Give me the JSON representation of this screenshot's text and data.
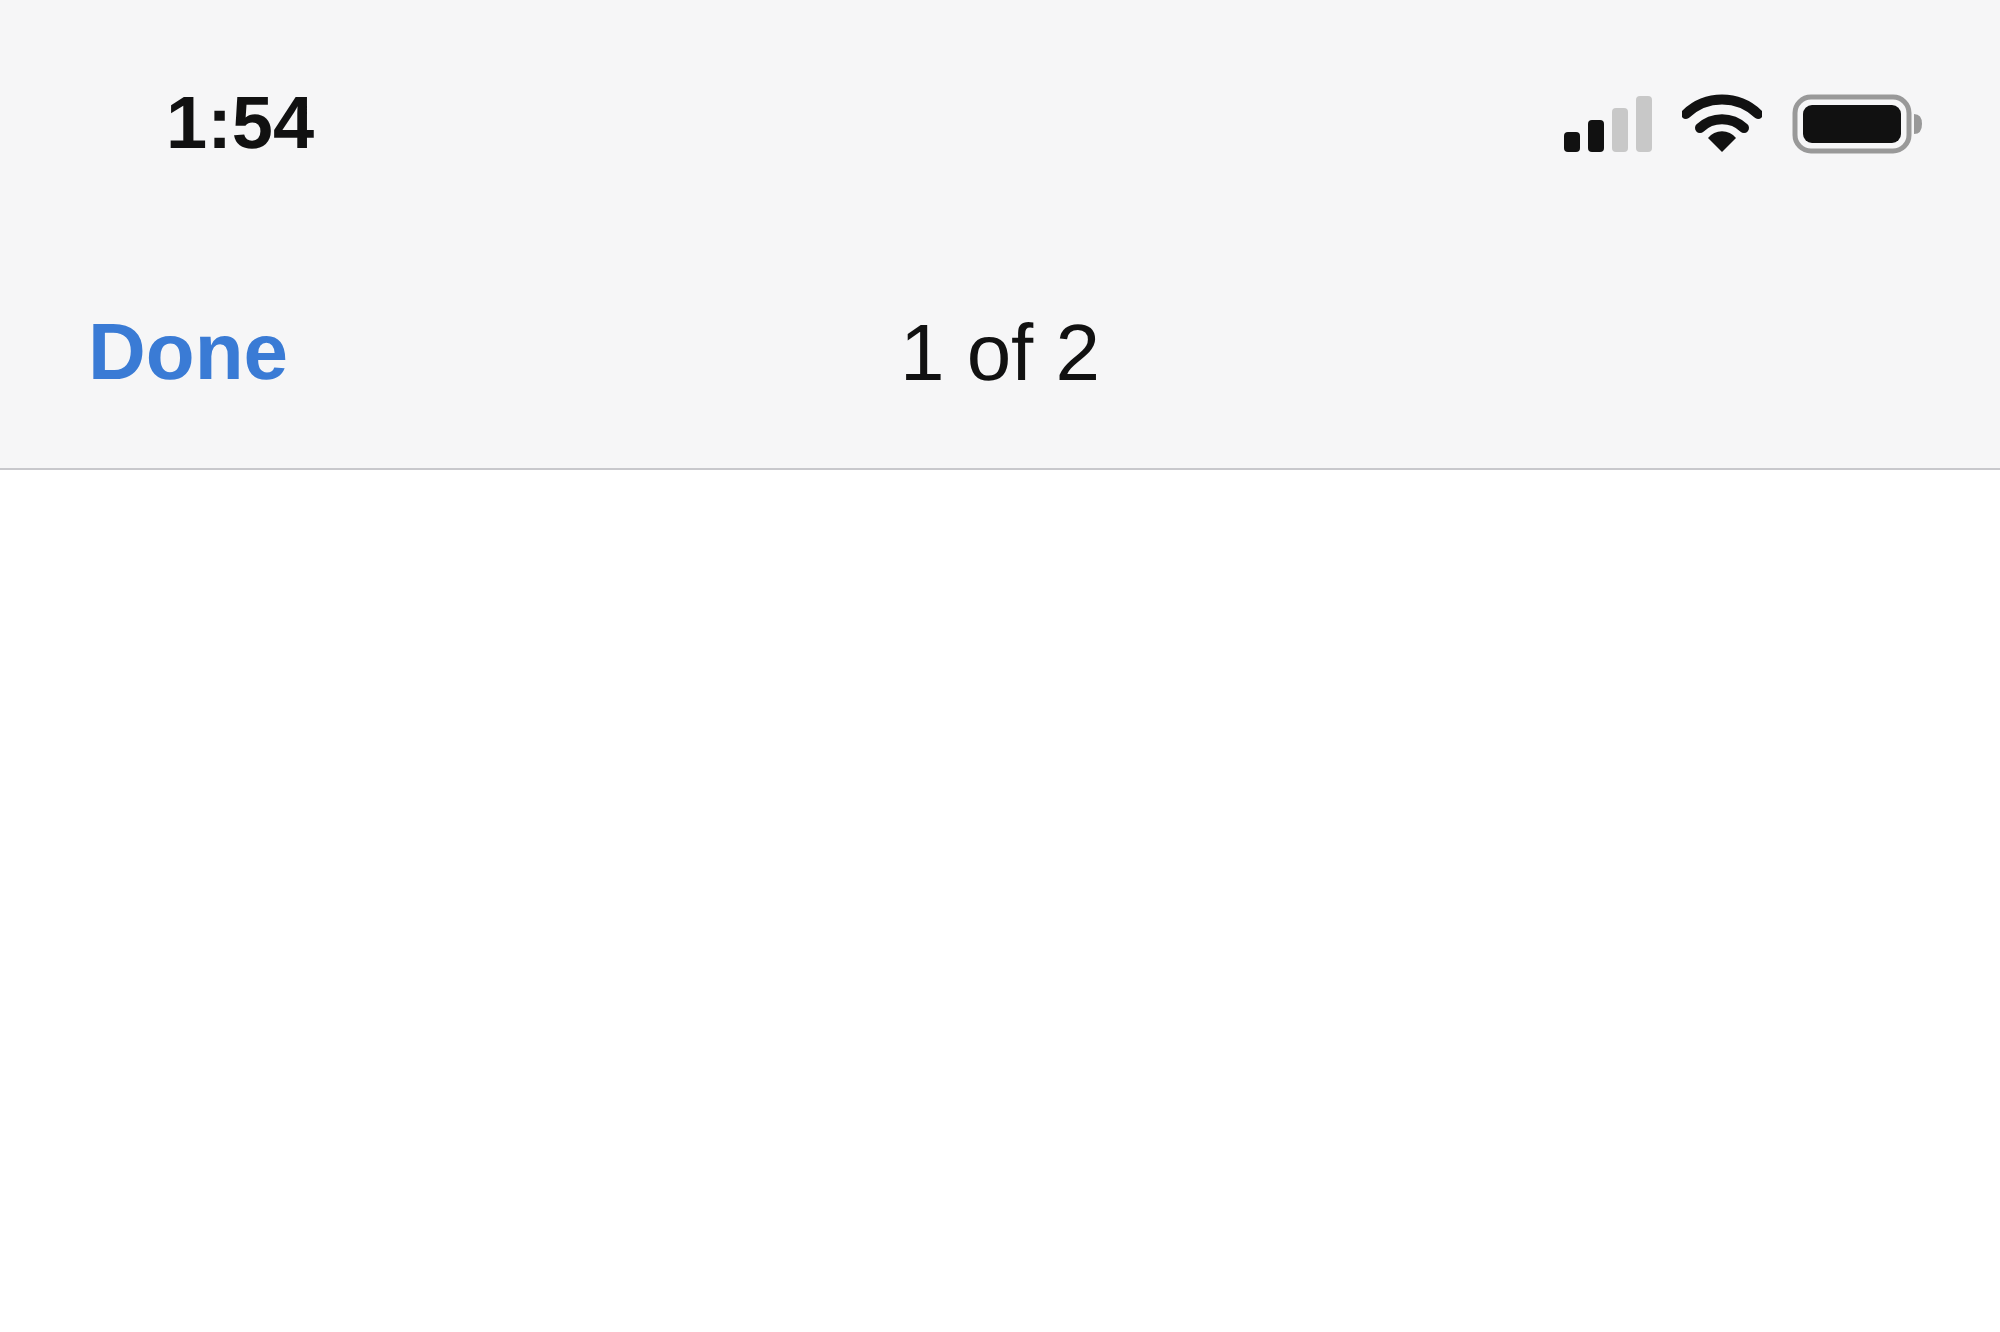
{
  "status_bar": {
    "time": "1:54"
  },
  "nav_bar": {
    "left_button": "Done",
    "title": "1 of 2"
  }
}
